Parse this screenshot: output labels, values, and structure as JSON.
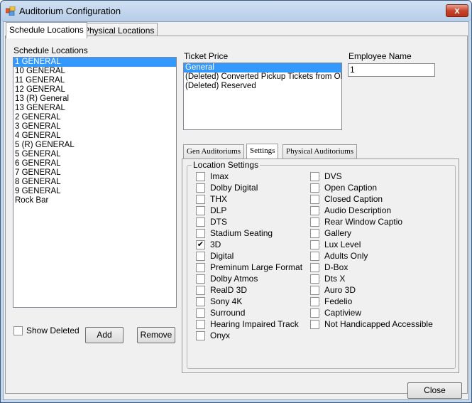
{
  "window": {
    "title": "Auditorium Configuration",
    "close_glyph": "x"
  },
  "tabs": [
    {
      "label": "Schedule Locations",
      "active": true
    },
    {
      "label": "Physical Locations",
      "active": false
    }
  ],
  "schedule_locations": {
    "label": "Schedule Locations",
    "selected_index": 0,
    "items": [
      "1 GENERAL",
      "10 GENERAL",
      "11 GENERAL",
      "12 GENERAL",
      "13 (R) General",
      "13 GENERAL",
      "2 GENERAL",
      "3 GENERAL",
      "4 GENERAL",
      "5 (R) GENERAL",
      "5 GENERAL",
      "6 GENERAL",
      "7 GENERAL",
      "8 GENERAL",
      "9 GENERAL",
      "Rock Bar"
    ]
  },
  "show_deleted": {
    "label": "Show Deleted",
    "checked": false
  },
  "add_button": "Add",
  "remove_button": "Remove",
  "ticket_price": {
    "label": "Ticket Price",
    "selected_index": 0,
    "items": [
      "General",
      "(Deleted) Converted Pickup Tickets from Old V",
      "(Deleted) Reserved"
    ]
  },
  "employee_name": {
    "label": "Employee Name",
    "value": "1"
  },
  "subtabs": [
    {
      "label": "Gen Auditoriums",
      "active": false
    },
    {
      "label": "Settings",
      "active": true
    },
    {
      "label": "Physical Auditoriums",
      "active": false
    }
  ],
  "location_settings": {
    "label": "Location Settings",
    "left": [
      {
        "label": "Imax",
        "checked": false
      },
      {
        "label": "Dolby Digital",
        "checked": false
      },
      {
        "label": "THX",
        "checked": false
      },
      {
        "label": "DLP",
        "checked": false
      },
      {
        "label": "DTS",
        "checked": false
      },
      {
        "label": "Stadium Seating",
        "checked": false
      },
      {
        "label": "3D",
        "checked": true
      },
      {
        "label": "Digital",
        "checked": false
      },
      {
        "label": "Preminum Large Format",
        "checked": false
      },
      {
        "label": "Dolby Atmos",
        "checked": false
      },
      {
        "label": "RealD 3D",
        "checked": false
      },
      {
        "label": "Sony 4K",
        "checked": false
      },
      {
        "label": "Surround",
        "checked": false
      },
      {
        "label": "Hearing Impaired Track",
        "checked": false
      },
      {
        "label": "Onyx",
        "checked": false
      }
    ],
    "right": [
      {
        "label": "DVS",
        "checked": false
      },
      {
        "label": "Open Caption",
        "checked": false
      },
      {
        "label": "Closed Caption",
        "checked": false
      },
      {
        "label": "Audio Description",
        "checked": false
      },
      {
        "label": "Rear Window Captio",
        "checked": false
      },
      {
        "label": "Gallery",
        "checked": false
      },
      {
        "label": "Lux Level",
        "checked": false
      },
      {
        "label": "Adults Only",
        "checked": false
      },
      {
        "label": "D-Box",
        "checked": false
      },
      {
        "label": "Dts X",
        "checked": false
      },
      {
        "label": "Auro 3D",
        "checked": false
      },
      {
        "label": "Fedelio",
        "checked": false
      },
      {
        "label": "Captiview",
        "checked": false
      },
      {
        "label": "Not Handicapped Accessible",
        "checked": false
      }
    ]
  },
  "close_button": "Close",
  "check_glyph": "✔"
}
